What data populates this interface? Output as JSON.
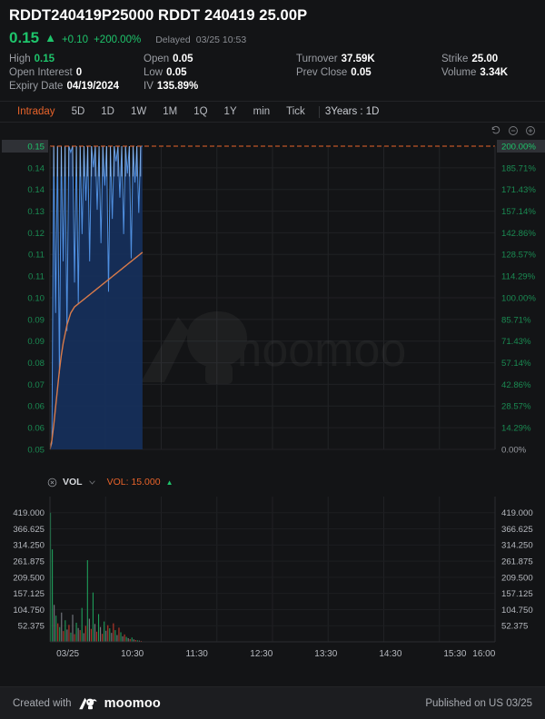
{
  "header": {
    "title": "RDDT240419P25000 RDDT 240419 25.00P",
    "last_price": "0.15",
    "arrow": "▲",
    "change": "+0.10",
    "change_pct": "+200.00%",
    "delay_label": "Delayed",
    "delay_time": "03/25 10:53",
    "accent_green": "#1ec46b",
    "stats": [
      {
        "key": "High",
        "value": "0.15",
        "green": true
      },
      {
        "key": "Open",
        "value": "0.05",
        "green": false
      },
      {
        "key": "Turnover",
        "value": "37.59K",
        "green": false
      },
      {
        "key": "Strike",
        "value": "25.00",
        "green": false
      },
      {
        "key": "Open Interest",
        "value": "0",
        "green": false
      },
      {
        "key": "Low",
        "value": "0.05",
        "green": false
      },
      {
        "key": "Prev Close",
        "value": "0.05",
        "green": false
      },
      {
        "key": "Volume",
        "value": "3.34K",
        "green": false
      },
      {
        "key": "Expiry Date",
        "value": "04/19/2024",
        "green": false
      },
      {
        "key": "IV",
        "value": "135.89%",
        "green": false
      }
    ]
  },
  "tabs": {
    "items": [
      {
        "label": "Intraday",
        "active": true
      },
      {
        "label": "5D",
        "active": false
      },
      {
        "label": "1D",
        "active": false
      },
      {
        "label": "1W",
        "active": false
      },
      {
        "label": "1M",
        "active": false
      },
      {
        "label": "1Q",
        "active": false
      },
      {
        "label": "1Y",
        "active": false
      },
      {
        "label": "min",
        "active": false
      },
      {
        "label": "Tick",
        "active": false
      }
    ],
    "range_label": "3Years : 1D",
    "active_color": "#e8632a"
  },
  "tools": {
    "reset_icon": "undo-icon",
    "zoom_out_icon": "zoom-out-icon",
    "zoom_in_icon": "zoom-in-icon"
  },
  "volume_panel": {
    "close_icon": "close-circle-icon",
    "name": "VOL",
    "chevron_icon": "chevron-down-icon",
    "value_label": "VOL: 15.000",
    "trend_arrow": "▲",
    "value_color": "#e8632a"
  },
  "watermark": {
    "text": "moomoo"
  },
  "footer": {
    "created_label": "Created with",
    "brand": "moomoo",
    "published": "Published on US 03/25"
  },
  "chart_data": {
    "type": "line",
    "title": "RDDT240419P25000 RDDT 240419 25.00P",
    "subtitle": "Intraday",
    "grid": true,
    "legend": "none",
    "xlabel": "",
    "ylabel": "",
    "x_ticks": [
      "03/25",
      "10:30",
      "11:30",
      "12:30",
      "13:30",
      "14:30",
      "15:30",
      "16:00"
    ],
    "x_tick_positions": [
      0.04,
      0.185,
      0.33,
      0.475,
      0.62,
      0.765,
      0.91,
      0.975
    ],
    "y_left_ticks": [
      "0.15",
      "0.14",
      "0.14",
      "0.13",
      "0.12",
      "0.11",
      "0.11",
      "0.10",
      "0.09",
      "0.09",
      "0.08",
      "0.07",
      "0.06",
      "0.06",
      "0.05"
    ],
    "y_right_ticks": [
      "200.00%",
      "185.71%",
      "171.43%",
      "157.14%",
      "142.86%",
      "128.57%",
      "114.29%",
      "100.00%",
      "85.71%",
      "71.43%",
      "57.14%",
      "42.86%",
      "28.57%",
      "14.29%",
      "0.00%"
    ],
    "ylim": [
      0.05,
      0.15
    ],
    "prev_close_line": {
      "value": 0.15,
      "pct": "200.00%",
      "color": "#e8632a",
      "style": "dashed"
    },
    "highlight_left": "0.15",
    "highlight_right": "200.00%",
    "series": [
      {
        "name": "Price",
        "color": "#4f8fe0",
        "fill": "#16305c",
        "type": "area",
        "values": [
          0.05,
          0.052,
          0.15,
          0.095,
          0.15,
          0.075,
          0.15,
          0.112,
          0.15,
          0.089,
          0.15,
          0.148,
          0.15,
          0.105,
          0.15,
          0.098,
          0.15,
          0.121,
          0.15,
          0.132,
          0.15,
          0.112,
          0.15,
          0.143,
          0.15,
          0.129,
          0.15,
          0.118,
          0.15,
          0.137,
          0.15,
          0.102,
          0.15,
          0.126,
          0.15,
          0.145,
          0.15,
          0.133,
          0.15,
          0.121,
          0.15,
          0.141,
          0.15,
          0.113,
          0.15,
          0.138,
          0.15,
          0.128,
          0.15,
          0.15
        ]
      },
      {
        "name": "Average Price",
        "color": "#d97b4a",
        "type": "line",
        "values": [
          0.05,
          0.053,
          0.058,
          0.064,
          0.07,
          0.076,
          0.081,
          0.085,
          0.088,
          0.091,
          0.093,
          0.095,
          0.096,
          0.097,
          0.0975,
          0.098,
          0.0985,
          0.099,
          0.0995,
          0.1,
          0.1005,
          0.101,
          0.1015,
          0.102,
          0.1025,
          0.103,
          0.1035,
          0.104,
          0.1045,
          0.105,
          0.1055,
          0.106,
          0.1065,
          0.107,
          0.1075,
          0.108,
          0.1085,
          0.109,
          0.1095,
          0.11,
          0.1105,
          0.111,
          0.1115,
          0.112,
          0.1125,
          0.113,
          0.1135,
          0.114,
          0.1145,
          0.115
        ]
      }
    ],
    "volume": {
      "ylabel": "",
      "y_ticks": [
        "419.000",
        "366.625",
        "314.250",
        "261.875",
        "209.500",
        "157.125",
        "104.750",
        "52.375"
      ],
      "ylim": [
        0,
        471.375
      ],
      "up_color": "#1e9e5a",
      "down_color": "#c0392b",
      "flat_color": "#7a7d84",
      "bars": [
        {
          "v": 419,
          "d": "up"
        },
        {
          "v": 300,
          "d": "up"
        },
        {
          "v": 120,
          "d": "flat"
        },
        {
          "v": 85,
          "d": "up"
        },
        {
          "v": 60,
          "d": "down"
        },
        {
          "v": 48,
          "d": "up"
        },
        {
          "v": 95,
          "d": "flat"
        },
        {
          "v": 35,
          "d": "down"
        },
        {
          "v": 70,
          "d": "up"
        },
        {
          "v": 40,
          "d": "flat"
        },
        {
          "v": 55,
          "d": "down"
        },
        {
          "v": 30,
          "d": "up"
        },
        {
          "v": 88,
          "d": "flat"
        },
        {
          "v": 25,
          "d": "down"
        },
        {
          "v": 62,
          "d": "up"
        },
        {
          "v": 45,
          "d": "flat"
        },
        {
          "v": 38,
          "d": "down"
        },
        {
          "v": 110,
          "d": "up"
        },
        {
          "v": 28,
          "d": "flat"
        },
        {
          "v": 52,
          "d": "down"
        },
        {
          "v": 265,
          "d": "up"
        },
        {
          "v": 75,
          "d": "flat"
        },
        {
          "v": 42,
          "d": "down"
        },
        {
          "v": 160,
          "d": "up"
        },
        {
          "v": 58,
          "d": "flat"
        },
        {
          "v": 33,
          "d": "down"
        },
        {
          "v": 90,
          "d": "up"
        },
        {
          "v": 48,
          "d": "flat"
        },
        {
          "v": 26,
          "d": "down"
        },
        {
          "v": 66,
          "d": "up"
        },
        {
          "v": 36,
          "d": "flat"
        },
        {
          "v": 54,
          "d": "down"
        },
        {
          "v": 44,
          "d": "up"
        },
        {
          "v": 29,
          "d": "flat"
        },
        {
          "v": 60,
          "d": "down"
        },
        {
          "v": 38,
          "d": "up"
        },
        {
          "v": 22,
          "d": "flat"
        },
        {
          "v": 46,
          "d": "down"
        },
        {
          "v": 31,
          "d": "up"
        },
        {
          "v": 18,
          "d": "flat"
        },
        {
          "v": 24,
          "d": "down"
        },
        {
          "v": 16,
          "d": "up"
        },
        {
          "v": 12,
          "d": "flat"
        },
        {
          "v": 9,
          "d": "down"
        },
        {
          "v": 14,
          "d": "up"
        },
        {
          "v": 8,
          "d": "flat"
        },
        {
          "v": 6,
          "d": "down"
        },
        {
          "v": 5,
          "d": "up"
        },
        {
          "v": 4,
          "d": "flat"
        },
        {
          "v": 3,
          "d": "down"
        }
      ]
    }
  }
}
